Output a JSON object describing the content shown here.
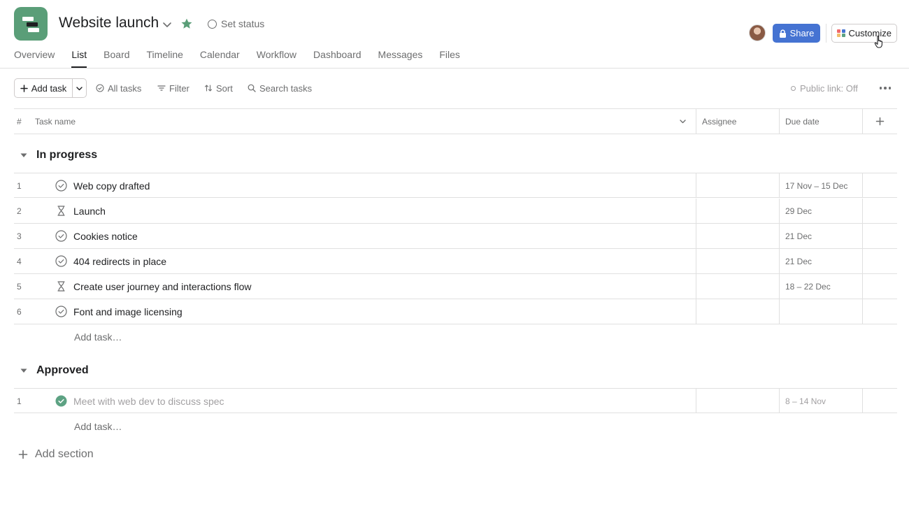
{
  "project": {
    "title": "Website launch",
    "set_status_label": "Set status",
    "accent_color": "#5a9e78"
  },
  "header_actions": {
    "share_label": "Share",
    "customize_label": "Customize",
    "share_color": "#4573d2"
  },
  "tabs": [
    {
      "label": "Overview",
      "active": false
    },
    {
      "label": "List",
      "active": true
    },
    {
      "label": "Board",
      "active": false
    },
    {
      "label": "Timeline",
      "active": false
    },
    {
      "label": "Calendar",
      "active": false
    },
    {
      "label": "Workflow",
      "active": false
    },
    {
      "label": "Dashboard",
      "active": false
    },
    {
      "label": "Messages",
      "active": false
    },
    {
      "label": "Files",
      "active": false
    }
  ],
  "toolbar": {
    "add_task_label": "Add task",
    "all_tasks_label": "All tasks",
    "filter_label": "Filter",
    "sort_label": "Sort",
    "search_label": "Search tasks",
    "public_link_label": "Public link: Off"
  },
  "columns": {
    "number": "#",
    "task_name": "Task name",
    "assignee": "Assignee",
    "due_date": "Due date"
  },
  "sections": [
    {
      "title": "In progress",
      "add_task_label": "Add task…",
      "tasks": [
        {
          "num": "1",
          "name": "Web copy drafted",
          "status_icon": "check-circle-icon",
          "due": "17 Nov – 15 Dec"
        },
        {
          "num": "2",
          "name": "Launch",
          "status_icon": "hourglass-icon",
          "due": "29 Dec"
        },
        {
          "num": "3",
          "name": "Cookies notice",
          "status_icon": "check-circle-icon",
          "due": "21 Dec"
        },
        {
          "num": "4",
          "name": "404 redirects in place",
          "status_icon": "check-circle-icon",
          "due": "21 Dec"
        },
        {
          "num": "5",
          "name": "Create user journey and interactions flow",
          "status_icon": "hourglass-icon",
          "due": "18 – 22 Dec"
        },
        {
          "num": "6",
          "name": "Font and image licensing",
          "status_icon": "check-circle-icon",
          "due": ""
        }
      ]
    },
    {
      "title": "Approved",
      "add_task_label": "Add task…",
      "tasks": [
        {
          "num": "1",
          "name": "Meet with web dev to discuss spec",
          "status_icon": "check-circle-filled-icon",
          "due": "8 – 14 Nov",
          "completed": true
        }
      ]
    }
  ],
  "add_section_label": "Add section"
}
